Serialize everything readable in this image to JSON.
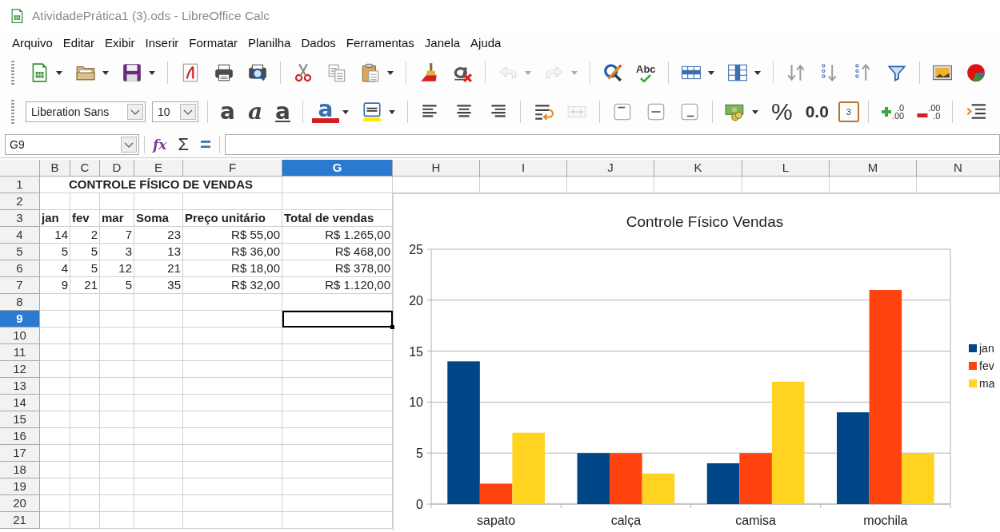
{
  "window": {
    "title": "AtividadePrática1 (3).ods - LibreOffice Calc"
  },
  "menu": [
    {
      "label": "Arquivo"
    },
    {
      "label": "Editar"
    },
    {
      "label": "Exibir"
    },
    {
      "label": "Inserir"
    },
    {
      "label": "Formatar"
    },
    {
      "label": "Planilha"
    },
    {
      "label": "Dados"
    },
    {
      "label": "Ferramentas"
    },
    {
      "label": "Janela"
    },
    {
      "label": "Ajuda"
    }
  ],
  "standard_toolbar": [
    {
      "kind": "grip",
      "disabled": false
    },
    {
      "kind": "new",
      "disabled": false
    },
    {
      "kind": "dropdown",
      "disabled": false
    },
    {
      "kind": "open",
      "disabled": false
    },
    {
      "kind": "dropdown",
      "disabled": false
    },
    {
      "kind": "save",
      "disabled": false
    },
    {
      "kind": "dropdown",
      "disabled": false
    },
    {
      "kind": "separator"
    },
    {
      "kind": "pdf",
      "disabled": false
    },
    {
      "kind": "print",
      "disabled": false
    },
    {
      "kind": "preview",
      "disabled": false
    },
    {
      "kind": "separator"
    },
    {
      "kind": "cut",
      "disabled": false
    },
    {
      "kind": "copy",
      "disabled": false
    },
    {
      "kind": "paste",
      "disabled": false
    },
    {
      "kind": "dropdown",
      "disabled": false
    },
    {
      "kind": "separator"
    },
    {
      "kind": "clone",
      "disabled": false
    },
    {
      "kind": "clear",
      "disabled": false
    },
    {
      "kind": "separator"
    },
    {
      "kind": "undo",
      "disabled": true
    },
    {
      "kind": "dropdown",
      "disabled": true
    },
    {
      "kind": "redo",
      "disabled": true
    },
    {
      "kind": "dropdown",
      "disabled": true
    },
    {
      "kind": "separator"
    },
    {
      "kind": "find",
      "disabled": false
    },
    {
      "kind": "spell",
      "label": "Abc",
      "disabled": false
    },
    {
      "kind": "separator"
    },
    {
      "kind": "rows",
      "disabled": false
    },
    {
      "kind": "dropdown",
      "disabled": false
    },
    {
      "kind": "columns",
      "disabled": false
    },
    {
      "kind": "dropdown",
      "disabled": false
    },
    {
      "kind": "separator"
    },
    {
      "kind": "sort",
      "disabled": false
    },
    {
      "kind": "sort-asc",
      "disabled": false
    },
    {
      "kind": "sort-desc",
      "disabled": false
    },
    {
      "kind": "filter",
      "disabled": false
    },
    {
      "kind": "separator"
    },
    {
      "kind": "image",
      "disabled": false
    },
    {
      "kind": "chart",
      "disabled": false
    }
  ],
  "formatting_toolbar": [
    {
      "kind": "grip",
      "disabled": false
    },
    {
      "kind": "font-name",
      "value": "Liberation Sans",
      "disabled": false
    },
    {
      "kind": "font-size",
      "value": "10",
      "disabled": false
    },
    {
      "kind": "separator"
    },
    {
      "kind": "bold",
      "label": "a",
      "disabled": false
    },
    {
      "kind": "italic",
      "label": "a",
      "disabled": false
    },
    {
      "kind": "underline",
      "label": "a",
      "disabled": false
    },
    {
      "kind": "separator"
    },
    {
      "kind": "font-color",
      "label": "a",
      "disabled": false
    },
    {
      "kind": "dropdown",
      "disabled": false
    },
    {
      "kind": "highlight",
      "disabled": false
    },
    {
      "kind": "dropdown",
      "disabled": false
    },
    {
      "kind": "separator"
    },
    {
      "kind": "align-left",
      "disabled": false
    },
    {
      "kind": "align-center",
      "disabled": false
    },
    {
      "kind": "align-right",
      "disabled": false
    },
    {
      "kind": "separator"
    },
    {
      "kind": "wrap",
      "disabled": false
    },
    {
      "kind": "merge",
      "disabled": true
    },
    {
      "kind": "separator"
    },
    {
      "kind": "valign-top",
      "disabled": false
    },
    {
      "kind": "valign-center",
      "disabled": false
    },
    {
      "kind": "valign-bottom",
      "disabled": false
    },
    {
      "kind": "separator"
    },
    {
      "kind": "currency",
      "disabled": false
    },
    {
      "kind": "dropdown",
      "disabled": false
    },
    {
      "kind": "percent",
      "label": "%",
      "disabled": false
    },
    {
      "kind": "number",
      "label": "0.0",
      "disabled": false
    },
    {
      "kind": "date",
      "label": "3",
      "disabled": false
    },
    {
      "kind": "separator"
    },
    {
      "kind": "add-decimal",
      "labels": [
        ".0",
        ".00"
      ],
      "disabled": false
    },
    {
      "kind": "delete-decimal",
      "labels": [
        ".00",
        ".0"
      ],
      "disabled": false
    },
    {
      "kind": "separator"
    },
    {
      "kind": "indent",
      "disabled": false
    }
  ],
  "formula_bar": {
    "name_box": "G9",
    "buttons": [
      {
        "kind": "function",
        "label": "fx"
      },
      {
        "kind": "sum",
        "label": "Σ"
      },
      {
        "kind": "formula",
        "label": "="
      }
    ]
  },
  "sheet": {
    "columns": [
      {
        "label": "B",
        "selected": false
      },
      {
        "label": "C",
        "selected": false
      },
      {
        "label": "D",
        "selected": false
      },
      {
        "label": "E",
        "selected": false
      },
      {
        "label": "F",
        "selected": false
      },
      {
        "label": "G",
        "selected": true
      },
      {
        "label": "H",
        "selected": false
      },
      {
        "label": "I",
        "selected": false
      },
      {
        "label": "J",
        "selected": false
      },
      {
        "label": "K",
        "selected": false
      },
      {
        "label": "L",
        "selected": false
      },
      {
        "label": "M",
        "selected": false
      },
      {
        "label": "N",
        "selected": false
      }
    ],
    "rows": [
      {
        "label": "1",
        "selected": false,
        "cells": [
          {
            "kind": "title",
            "text": "CONTROLE FÍSICO DE VENDAS"
          }
        ]
      },
      {
        "label": "2",
        "selected": false
      },
      {
        "label": "3",
        "selected": false,
        "cells": [
          {
            "kind": "header",
            "text": "jan"
          },
          {
            "kind": "header",
            "text": "fev"
          },
          {
            "kind": "header",
            "text": "mar"
          },
          {
            "kind": "header",
            "text": "Soma"
          },
          {
            "kind": "header",
            "text": "Preço unitário"
          },
          {
            "kind": "header",
            "text": "Total de vendas"
          }
        ]
      },
      {
        "label": "4",
        "selected": false,
        "cells": [
          {
            "kind": "number",
            "text": "14"
          },
          {
            "kind": "number",
            "text": "2"
          },
          {
            "kind": "number",
            "text": "7"
          },
          {
            "kind": "number",
            "text": "23"
          },
          {
            "kind": "number",
            "text": "R$ 55,00"
          },
          {
            "kind": "number",
            "text": "R$ 1.265,00"
          }
        ]
      },
      {
        "label": "5",
        "selected": false,
        "cells": [
          {
            "kind": "number",
            "text": "5"
          },
          {
            "kind": "number",
            "text": "5"
          },
          {
            "kind": "number",
            "text": "3"
          },
          {
            "kind": "number",
            "text": "13"
          },
          {
            "kind": "number",
            "text": "R$ 36,00"
          },
          {
            "kind": "number",
            "text": "R$ 468,00"
          }
        ]
      },
      {
        "label": "6",
        "selected": false,
        "cells": [
          {
            "kind": "number",
            "text": "4"
          },
          {
            "kind": "number",
            "text": "5"
          },
          {
            "kind": "number",
            "text": "12"
          },
          {
            "kind": "number",
            "text": "21"
          },
          {
            "kind": "number",
            "text": "R$ 18,00"
          },
          {
            "kind": "number",
            "text": "R$ 378,00"
          }
        ]
      },
      {
        "label": "7",
        "selected": false,
        "cells": [
          {
            "kind": "number",
            "text": "9"
          },
          {
            "kind": "number",
            "text": "21"
          },
          {
            "kind": "number",
            "text": "5"
          },
          {
            "kind": "number",
            "text": "35"
          },
          {
            "kind": "number",
            "text": "R$ 32,00"
          },
          {
            "kind": "number",
            "text": "R$ 1.120,00"
          }
        ]
      },
      {
        "label": "8",
        "selected": false
      },
      {
        "label": "9",
        "selected": true
      },
      {
        "label": "10",
        "selected": false
      },
      {
        "label": "11",
        "selected": false
      },
      {
        "label": "12",
        "selected": false
      },
      {
        "label": "13",
        "selected": false
      },
      {
        "label": "14",
        "selected": false
      },
      {
        "label": "15",
        "selected": false
      },
      {
        "label": "16",
        "selected": false
      },
      {
        "label": "17",
        "selected": false
      },
      {
        "label": "18",
        "selected": false
      },
      {
        "label": "19",
        "selected": false
      },
      {
        "label": "20",
        "selected": false
      },
      {
        "label": "21",
        "selected": false
      }
    ],
    "chart_data": {
      "type": "bar",
      "title": "Controle Físico Vendas",
      "categories": [
        "sapato",
        "calça",
        "camisa",
        "mochila"
      ],
      "series": [
        {
          "name": "jan",
          "color": "#004586",
          "values": [
            14,
            5,
            4,
            9
          ]
        },
        {
          "name": "fev",
          "color": "#ff420e",
          "values": [
            2,
            5,
            5,
            21
          ]
        },
        {
          "name": "ma",
          "color": "#ffd320",
          "values": [
            7,
            3,
            12,
            5
          ]
        }
      ],
      "ylim": [
        0,
        25
      ],
      "yticks": [
        {
          "value": 0,
          "label": "0"
        },
        {
          "value": 5,
          "label": "5"
        },
        {
          "value": 10,
          "label": "10"
        },
        {
          "value": 15,
          "label": "15"
        },
        {
          "value": 20,
          "label": "20"
        },
        {
          "value": 25,
          "label": "25"
        }
      ],
      "grid": true,
      "legend": true
    }
  }
}
